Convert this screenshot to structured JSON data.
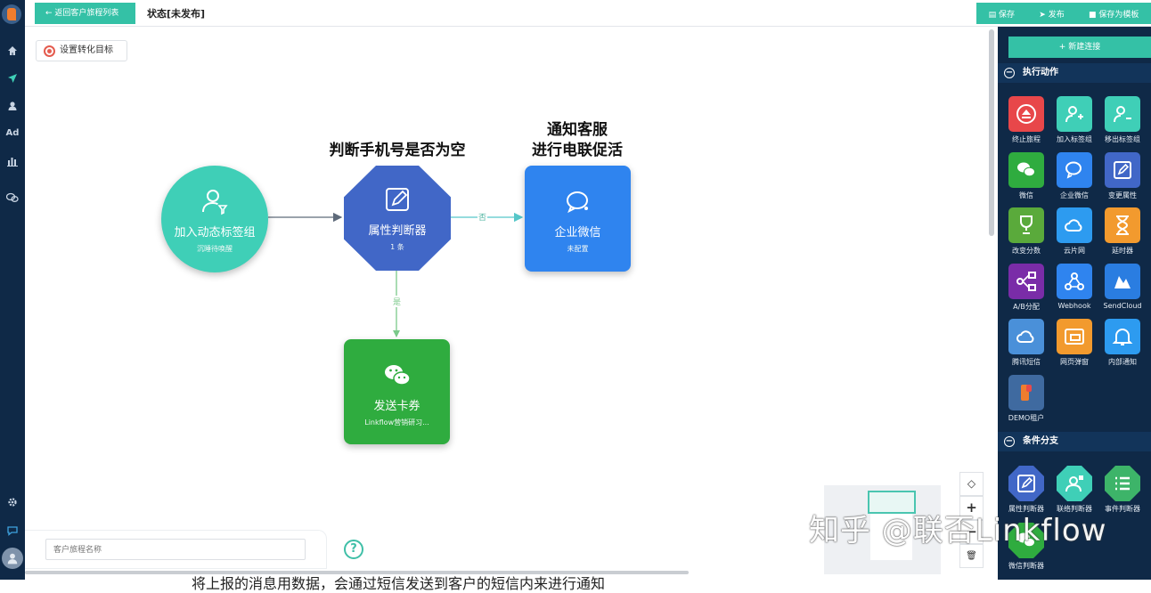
{
  "top": {
    "back_label": "← 返回客户旅程列表",
    "title": "状态[未发布]",
    "save_label": "保存",
    "publish_label": "发布",
    "save_template_label": "保存为模板"
  },
  "nav": {
    "icons": [
      "logo",
      "home-icon",
      "send-icon",
      "user-icon",
      "ad-icon",
      "bar-chart-icon",
      "chat-icon",
      "gear-icon",
      "message-icon",
      "avatar"
    ],
    "ad_text": "Ad"
  },
  "canvas": {
    "goal_button": "设置转化目标",
    "name_placeholder": "客户旅程名称",
    "help": "?"
  },
  "flow": {
    "captions": {
      "n2": "判断手机号是否为空",
      "n3_line1": "通知客服",
      "n3_line2": "进行电联促活"
    },
    "nodes": [
      {
        "id": "n1",
        "name": "加入动态标签组",
        "sub": "沉睡待唤醒",
        "color": "#3fcfb7",
        "icon": "user-tag-icon"
      },
      {
        "id": "n2",
        "name": "属性判断器",
        "sub": "1 条",
        "color": "#4167c7",
        "icon": "edit-icon"
      },
      {
        "id": "n3",
        "name": "企业微信",
        "sub": "未配置",
        "color": "#2f84ef",
        "icon": "wecom-icon"
      },
      {
        "id": "n4",
        "name": "发送卡券",
        "sub": "Linkflow营销研习...",
        "color": "#2fac3f",
        "icon": "wechat-icon"
      }
    ],
    "edge_labels": {
      "no": "否",
      "yes": "是"
    }
  },
  "zoom": {
    "fit": "◇",
    "in": "+",
    "out": "−",
    "delete": "🗑"
  },
  "right_panel": {
    "new_connection": "+ 新建连接",
    "section1": "执行动作",
    "section2": "条件分支",
    "actions": [
      {
        "label": "终止旅程",
        "color": "#e8474a",
        "icon": "stop-icon"
      },
      {
        "label": "加入标签组",
        "color": "#3fcfb7",
        "icon": "user-add-icon"
      },
      {
        "label": "移出标签组",
        "color": "#3fcfb7",
        "icon": "user-remove-icon"
      },
      {
        "label": "微信",
        "color": "#2fac3f",
        "icon": "wechat-icon"
      },
      {
        "label": "企业微信",
        "color": "#2f84ef",
        "icon": "wecom-icon"
      },
      {
        "label": "变更属性",
        "color": "#4167c7",
        "icon": "edit-icon"
      },
      {
        "label": "改变分数",
        "color": "#5aaa3b",
        "icon": "trophy-icon"
      },
      {
        "label": "云片网",
        "color": "#2d9bf0",
        "icon": "cloud-icon"
      },
      {
        "label": "延时器",
        "color": "#f29a2e",
        "icon": "hourglass-icon"
      },
      {
        "label": "A/B分配",
        "color": "#7a2ca8",
        "icon": "split-icon"
      },
      {
        "label": "Webhook",
        "color": "#2f84ef",
        "icon": "webhook-icon"
      },
      {
        "label": "SendCloud",
        "color": "#2a7de1",
        "icon": "sendcloud-icon"
      },
      {
        "label": "腾讯短信",
        "color": "#4a90d9",
        "icon": "tencent-cloud-icon"
      },
      {
        "label": "网页弹窗",
        "color": "#f29a2e",
        "icon": "popup-icon"
      },
      {
        "label": "内部通知",
        "color": "#2d9bf0",
        "icon": "bell-icon"
      },
      {
        "label": "DEMO租户",
        "color": "#3f6aa0",
        "icon": "demo-logo-icon"
      }
    ],
    "branches": [
      {
        "label": "属性判断器",
        "color": "#4167c7",
        "icon": "edit-icon"
      },
      {
        "label": "联络判断器",
        "color": "#3fcfb7",
        "icon": "contact-icon"
      },
      {
        "label": "事件判断器",
        "color": "#3db469",
        "icon": "list-icon"
      },
      {
        "label": "微信判断器",
        "color": "#2fac3f",
        "icon": "wechat-icon"
      }
    ]
  },
  "watermark": "知乎 @联否Linkflow",
  "subtitle": "将上报的消息用数据，会通过短信发送到客户的短信内来进行通知"
}
